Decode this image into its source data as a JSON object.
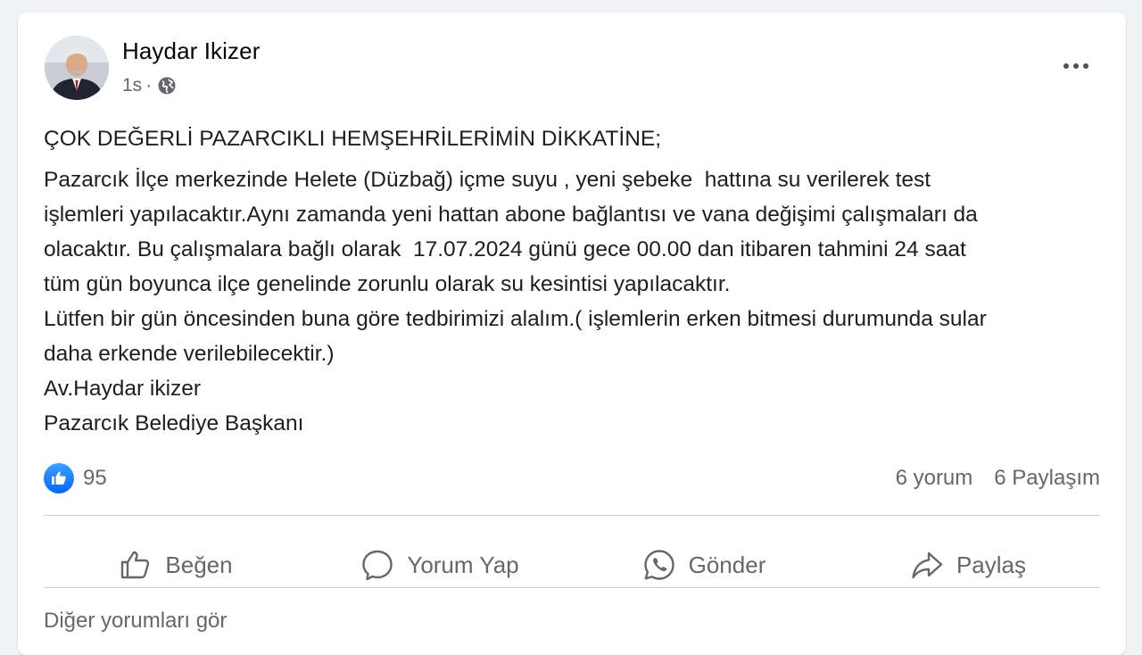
{
  "post": {
    "author": "Haydar Ikizer",
    "time": "1s",
    "separator": "·",
    "heading": "ÇOK DEĞERLİ PAZARCIKLI HEMŞEHRİLERİMİN DİKKATİNE;",
    "lines": [
      "Pazarcık İlçe merkezinde Helete (Düzbağ) içme suyu , yeni şebeke  hattına su verilerek test",
      "işlemleri yapılacaktır.Aynı zamanda yeni hattan abone bağlantısı ve vana değişimi çalışmaları da",
      "olacaktır. Bu çalışmalara bağlı olarak  17.07.2024 günü gece 00.00 dan itibaren tahmini 24 saat",
      "tüm gün boyunca ilçe genelinde zorunlu olarak su kesintisi yapılacaktır.",
      "Lütfen bir gün öncesinden buna göre tedbirimizi alalım.( işlemlerin erken bitmesi durumunda sular",
      "daha erkende verilebilecektir.)",
      "Av.Haydar ikizer",
      "Pazarcık Belediye Başkanı"
    ]
  },
  "stats": {
    "reactions": "95",
    "comments": "6 yorum",
    "shares": "6 Paylaşım"
  },
  "actions": {
    "like": "Beğen",
    "comment": "Yorum Yap",
    "send": "Gönder",
    "share": "Paylaş"
  },
  "comments_link": "Diğer yorumları gör",
  "colors": {
    "like_blue": "#0866ff",
    "secondary_text": "#65676b",
    "divider": "#ced0d4"
  }
}
